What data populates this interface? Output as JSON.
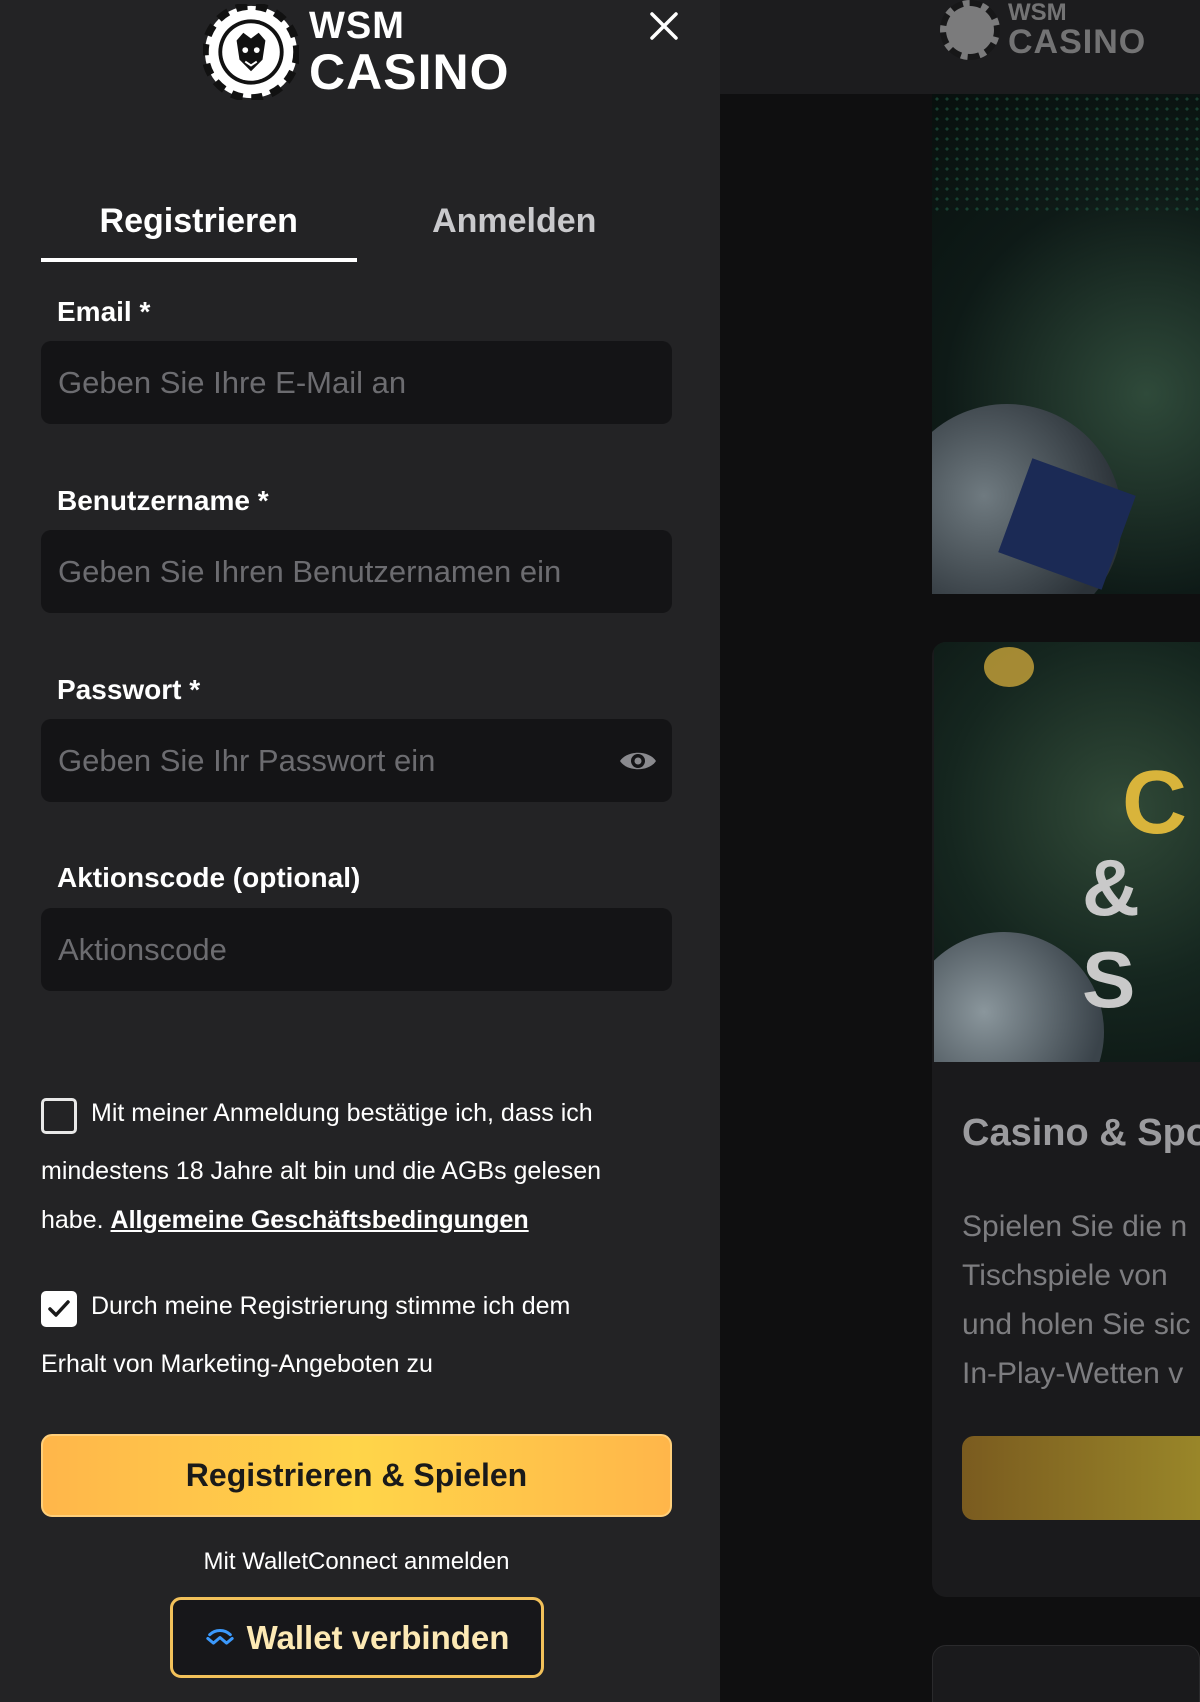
{
  "brand": {
    "line1": "WSM",
    "line2": "CASINO"
  },
  "tabs": [
    {
      "label": "Registrieren",
      "active": true
    },
    {
      "label": "Anmelden",
      "active": false
    }
  ],
  "form": {
    "email": {
      "label": "Email *",
      "placeholder": "Geben Sie Ihre E-Mail an",
      "value": ""
    },
    "username": {
      "label": "Benutzername *",
      "placeholder": "Geben Sie Ihren Benutzernamen ein",
      "value": ""
    },
    "password": {
      "label": "Passwort *",
      "placeholder": "Geben Sie Ihr Passwort ein",
      "value": ""
    },
    "promo": {
      "label": "Aktionscode (optional)",
      "placeholder": "Aktionscode",
      "value": ""
    }
  },
  "consent": {
    "age": {
      "checked": false,
      "line1": "Mit meiner Anmeldung bestätige ich, dass ich",
      "line2": "mindestens 18 Jahre alt bin und die AGBs gelesen",
      "line3": "habe.",
      "link": "Allgemeine Geschäftsbedingungen"
    },
    "marketing": {
      "checked": true,
      "line1": "Durch meine Registrierung stimme ich dem",
      "line2": "Erhalt von Marketing-Angeboten zu"
    }
  },
  "primary_button": "Registrieren & Spielen",
  "wallet": {
    "caption": "Mit WalletConnect anmelden",
    "button": "Wallet verbinden"
  },
  "background": {
    "card_title": "Casino & Spo",
    "card_lines": [
      "Spielen Sie die n",
      "Tischspiele von",
      "und holen Sie sic",
      "In-Play-Wetten v"
    ],
    "banner_big": "C",
    "banner_amp": "& S"
  },
  "colors": {
    "panel": "#232325",
    "input": "#141416",
    "accent_gold": "#ffd549",
    "wallet_blue": "#3b99fc"
  }
}
